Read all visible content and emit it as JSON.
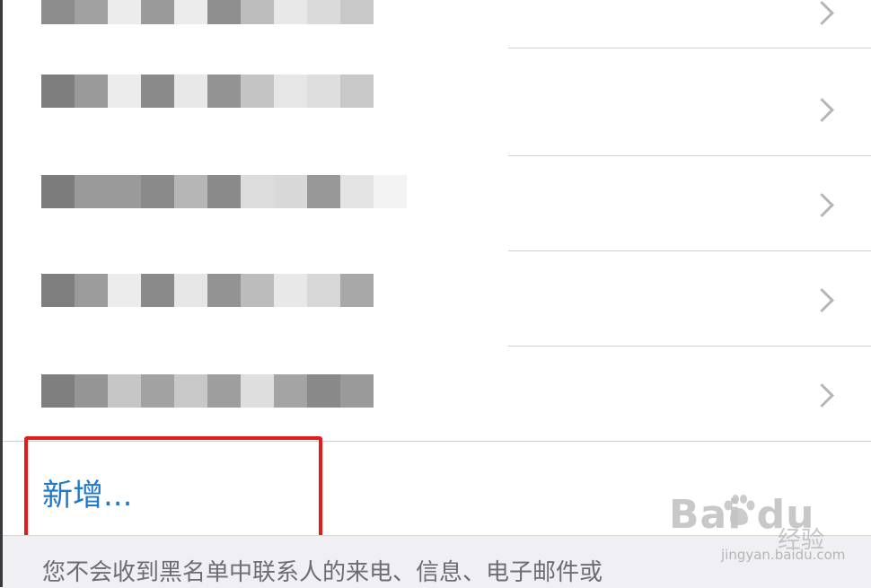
{
  "rows": [
    {
      "name": "blocked-contact-1",
      "pixels": [
        "#8c8c8c",
        "#a0a0a0",
        "#ececec",
        "#9a9a9a",
        "#ececec",
        "#8f8f8f",
        "#bdbdbd",
        "#e8e8e8",
        "#dadada",
        "#c8c8c8"
      ]
    },
    {
      "name": "blocked-contact-2",
      "pixels": [
        "#7e7e7e",
        "#9a9a9a",
        "#ececec",
        "#8a8a8a",
        "#e8e8e8",
        "#939393",
        "#c4c4c4",
        "#e6e6e6",
        "#dedede",
        "#c8c8c8"
      ]
    },
    {
      "name": "blocked-contact-3",
      "pixels": [
        "#7c7c7c",
        "#9a9a9a",
        "#9a9a9a",
        "#8a8a8a",
        "#b6b6b6",
        "#8a8a8a",
        "#dcdcdc",
        "#d8d8d8",
        "#989898",
        "#e4e4e4",
        "#f3f3f3"
      ]
    },
    {
      "name": "blocked-contact-4",
      "pixels": [
        "#7f7f7f",
        "#9b9b9b",
        "#ececec",
        "#8a8a8a",
        "#e6e6e6",
        "#939393",
        "#bcbcbc",
        "#e8e8e8",
        "#d8d8d8",
        "#a8a8a8"
      ]
    },
    {
      "name": "blocked-contact-5",
      "pixels": [
        "#7f7f7f",
        "#959595",
        "#c6c6c6",
        "#a2a2a2",
        "#c8c8c8",
        "#9e9e9e",
        "#dedede",
        "#a4a4a4",
        "#898989",
        "#9a9a9a"
      ]
    }
  ],
  "add_new": {
    "label": "新增..."
  },
  "footer": {
    "text": "您不会收到黑名单中联系人的来电、信息、电子邮件或"
  },
  "colors": {
    "accent": "#1f78c9",
    "highlight": "#e51b1b"
  },
  "icons": {
    "row_disclosure": "chevron-right-icon",
    "watermark": "baidu-paw-icon"
  },
  "watermark": {
    "logo_text": "Bai du",
    "text": "经验",
    "url": "jingyan.baidu.com"
  }
}
